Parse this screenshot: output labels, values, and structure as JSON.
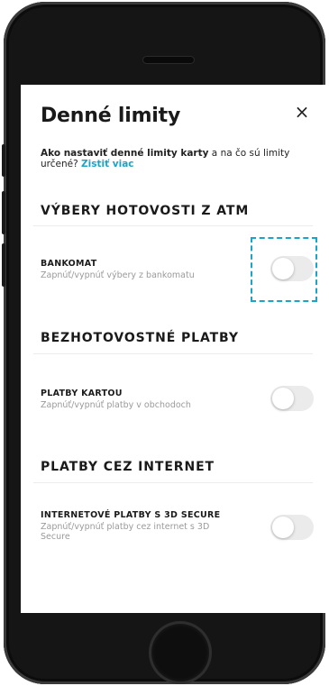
{
  "header": {
    "title": "Denné limity",
    "close_glyph": "×"
  },
  "intro": {
    "bold": "Ako nastaviť denné limity karty",
    "text": " a na čo sú limity určené? ",
    "link": "Zistiť viac"
  },
  "sections": [
    {
      "title": "VÝBERY HOTOVOSTI Z ATM",
      "rows": [
        {
          "title": "BANKOMAT",
          "subtitle": "Zapnúť/vypnúť výbery z bankomatu",
          "enabled": false
        }
      ]
    },
    {
      "title": "BEZHOTOVOSTNÉ PLATBY",
      "rows": [
        {
          "title": "PLATBY KARTOU",
          "subtitle": "Zapnúť/vypnúť platby v obchodoch",
          "enabled": false
        }
      ]
    },
    {
      "title": "PLATBY CEZ INTERNET",
      "rows": [
        {
          "title": "INTERNETOVÉ PLATBY S 3D SECURE",
          "subtitle": "Zapnúť/vypnúť platby cez internet s 3D Secure",
          "enabled": false
        }
      ]
    }
  ],
  "colors": {
    "accent": "#1aa4c7",
    "toggle_off": "#ebebeb",
    "text": "#1a1a1a",
    "muted": "#9a9a9a"
  },
  "icons": {
    "close": "close-icon"
  }
}
